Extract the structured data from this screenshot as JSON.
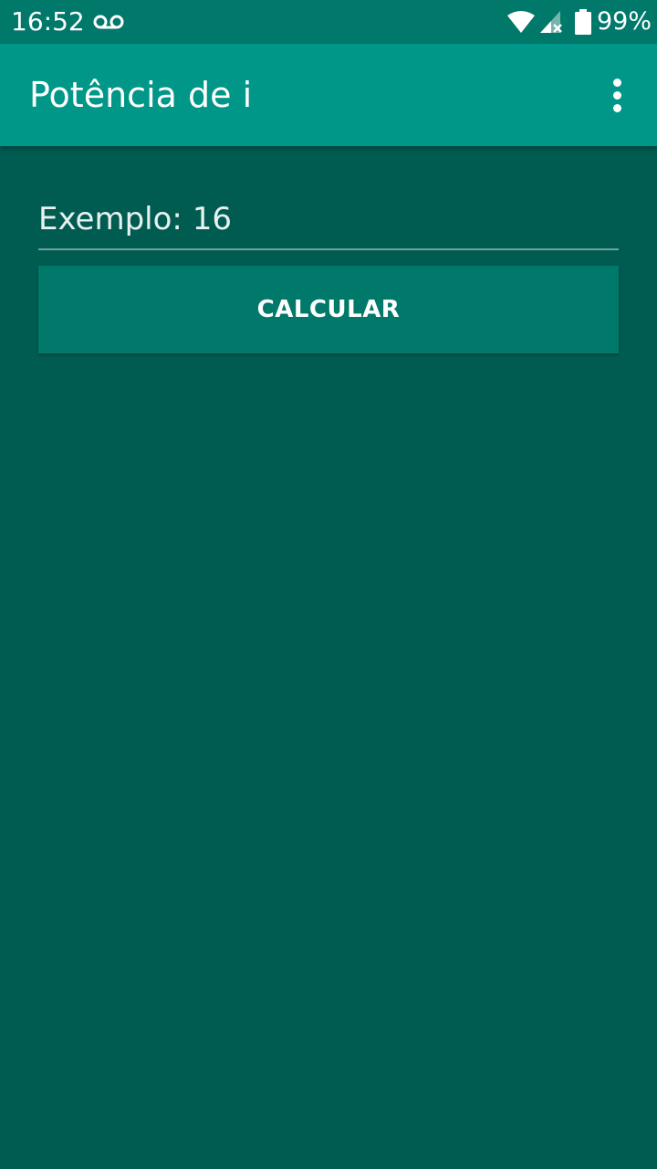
{
  "status_bar": {
    "time": "16:52",
    "battery_percent": "99%",
    "battery_level": 0.99,
    "icons": [
      "voicemail-icon",
      "wifi-icon",
      "cell-signal-no-data-icon",
      "battery-icon"
    ]
  },
  "app_bar": {
    "title": "Potência de i",
    "menu_icon": "more-vert-icon"
  },
  "form": {
    "input_placeholder": "Exemplo: 16",
    "input_value": "",
    "button_label": "CALCULAR"
  },
  "colors": {
    "status_bar": "#00796B",
    "app_bar": "#009688",
    "background": "#005B51",
    "button": "#00796B",
    "text": "#FFFFFF"
  }
}
